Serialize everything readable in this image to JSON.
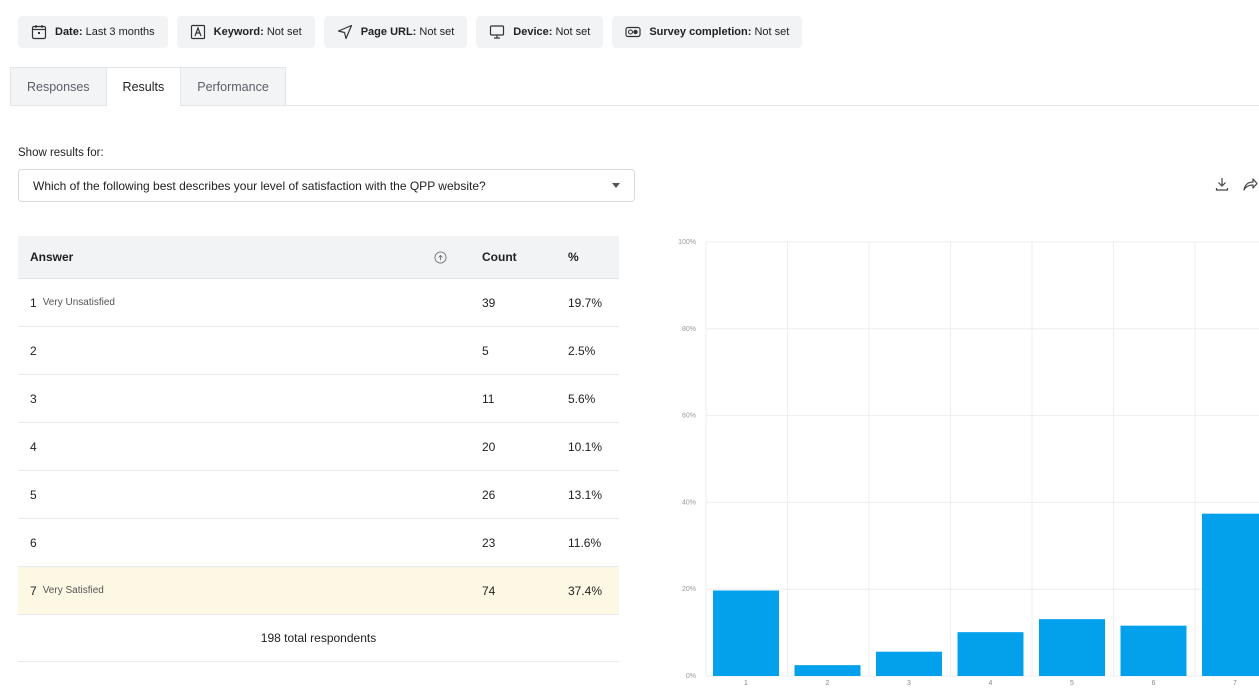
{
  "filters": [
    {
      "label": "Date:",
      "value": "Last 3 months",
      "icon": "calendar-icon"
    },
    {
      "label": "Keyword:",
      "value": "Not set",
      "icon": "keyword-box-icon"
    },
    {
      "label": "Page URL:",
      "value": "Not set",
      "icon": "pointer-arrow-icon"
    },
    {
      "label": "Device:",
      "value": "Not set",
      "icon": "monitor-icon"
    },
    {
      "label": "Survey completion:",
      "value": "Not set",
      "icon": "toggle-icon"
    }
  ],
  "tabs": [
    {
      "label": "Responses",
      "active": false
    },
    {
      "label": "Results",
      "active": true
    },
    {
      "label": "Performance",
      "active": false
    }
  ],
  "results": {
    "show_label": "Show results for:",
    "selected_question": "Which of the following best describes your level of satisfaction with the QPP website?"
  },
  "toolbar": {
    "icons": [
      "download-icon",
      "share-icon"
    ]
  },
  "table": {
    "headers": {
      "answer": "Answer",
      "count": "Count",
      "percent": "%"
    },
    "rows": [
      {
        "answer": "1",
        "sublabel": "Very Unsatisfied",
        "count": "39",
        "percent": "19.7%",
        "highlight": false
      },
      {
        "answer": "2",
        "sublabel": "",
        "count": "5",
        "percent": "2.5%",
        "highlight": false
      },
      {
        "answer": "3",
        "sublabel": "",
        "count": "11",
        "percent": "5.6%",
        "highlight": false
      },
      {
        "answer": "4",
        "sublabel": "",
        "count": "20",
        "percent": "10.1%",
        "highlight": false
      },
      {
        "answer": "5",
        "sublabel": "",
        "count": "26",
        "percent": "13.1%",
        "highlight": false
      },
      {
        "answer": "6",
        "sublabel": "",
        "count": "23",
        "percent": "11.6%",
        "highlight": false
      },
      {
        "answer": "7",
        "sublabel": "Very Satisfied",
        "count": "74",
        "percent": "37.4%",
        "highlight": true
      }
    ],
    "total": "198 total respondents",
    "highlight_color": "#fdf8e4"
  },
  "chart_data": {
    "type": "bar",
    "categories": [
      "1",
      "2",
      "3",
      "4",
      "5",
      "6",
      "7"
    ],
    "values": [
      19.7,
      2.5,
      5.6,
      10.1,
      13.1,
      11.6,
      37.4
    ],
    "yticks": [
      "0%",
      "20%",
      "40%",
      "60%",
      "80%",
      "100%"
    ],
    "ylim": [
      0,
      100
    ],
    "bar_color": "#03a1ec",
    "grid": true
  }
}
